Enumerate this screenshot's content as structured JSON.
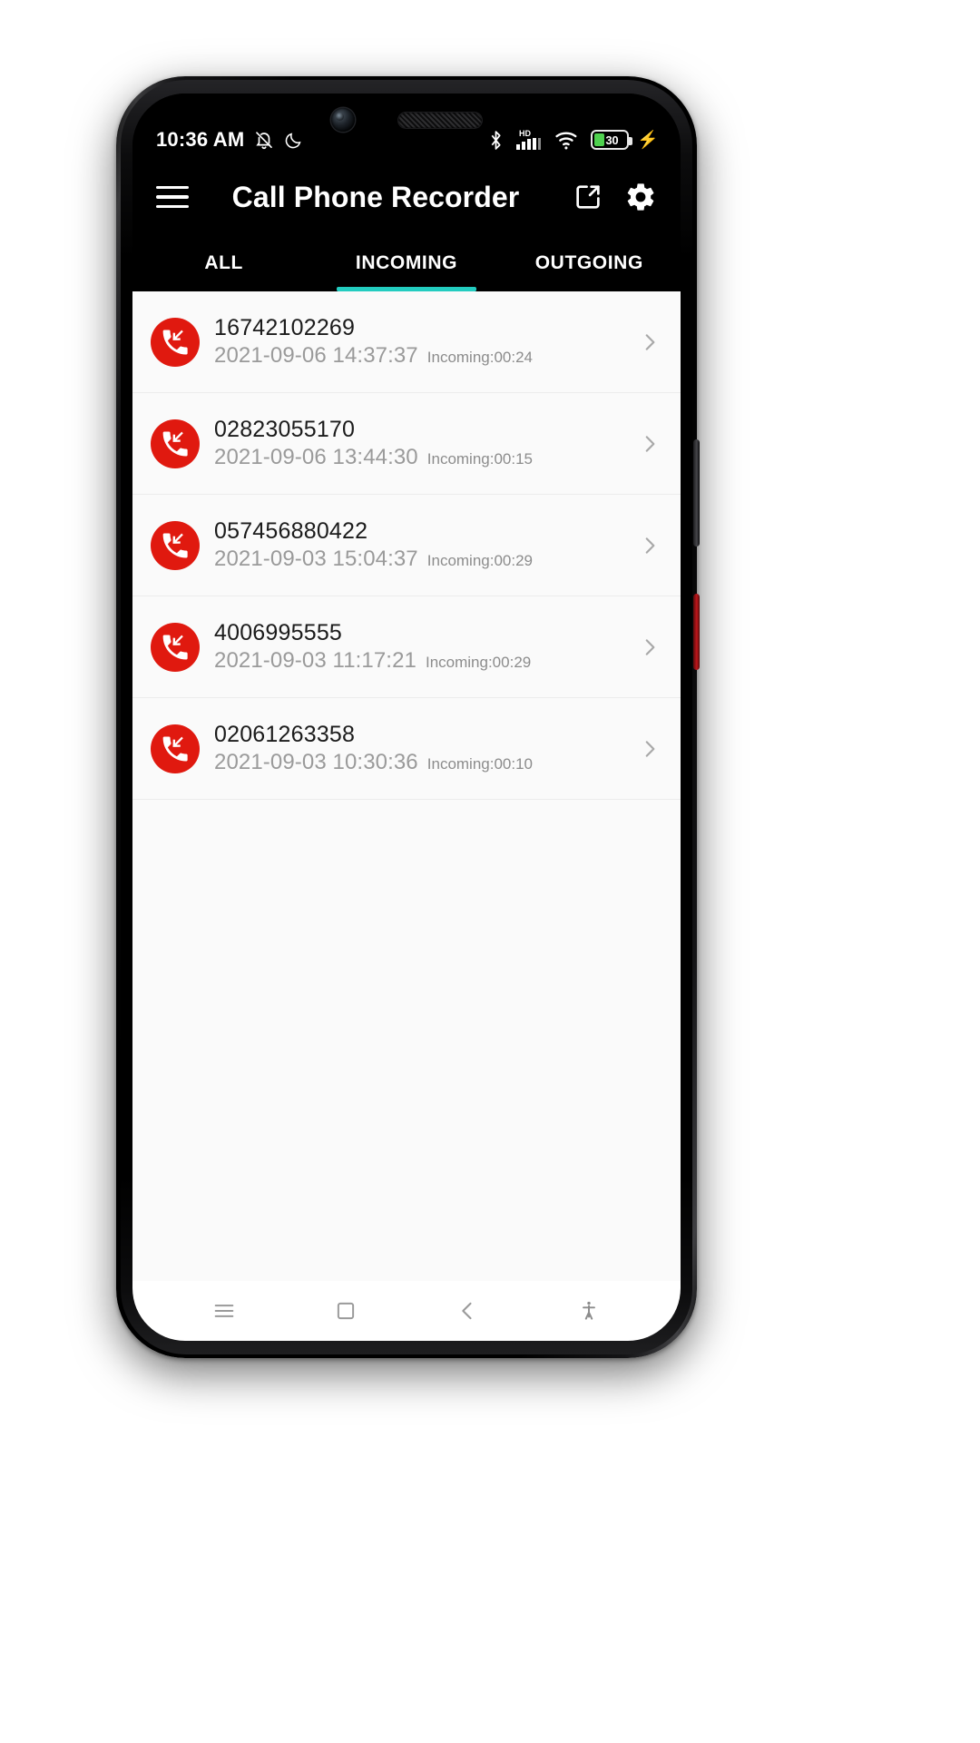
{
  "status_bar": {
    "time": "10:36 AM",
    "left_icons": [
      "bell-muted-icon",
      "dnd-moon-icon"
    ],
    "right_icons": [
      "bluetooth-icon",
      "hd-signal-icon",
      "wifi-icon"
    ],
    "hd_label": "HD",
    "battery_percent": "30",
    "battery_charging": true,
    "battery_color": "#4fd14f"
  },
  "app_bar": {
    "menu_icon": "hamburger-menu-icon",
    "title": "Call Phone Recorder",
    "export_icon": "export-share-icon",
    "settings_icon": "gear-icon"
  },
  "tabs": {
    "active_index": 1,
    "accent_color": "#23ccc0",
    "items": [
      {
        "label": "ALL"
      },
      {
        "label": "INCOMING"
      },
      {
        "label": "OUTGOING"
      }
    ]
  },
  "call_list": {
    "icon_color": "#e0190f",
    "icon_name": "incoming-call-icon",
    "chevron_icon": "chevron-right-icon",
    "rows": [
      {
        "number": "16742102269",
        "datetime": "2021-09-06 14:37:37",
        "duration": "Incoming:00:24"
      },
      {
        "number": "02823055170",
        "datetime": "2021-09-06 13:44:30",
        "duration": "Incoming:00:15"
      },
      {
        "number": "057456880422",
        "datetime": "2021-09-03 15:04:37",
        "duration": "Incoming:00:29"
      },
      {
        "number": "4006995555",
        "datetime": "2021-09-03 11:17:21",
        "duration": "Incoming:00:29"
      },
      {
        "number": "02061263358",
        "datetime": "2021-09-03 10:30:36",
        "duration": "Incoming:00:10"
      }
    ]
  },
  "nav_bar": {
    "items": [
      "recents-menu-icon",
      "home-square-icon",
      "back-chevron-icon",
      "accessibility-icon"
    ]
  }
}
